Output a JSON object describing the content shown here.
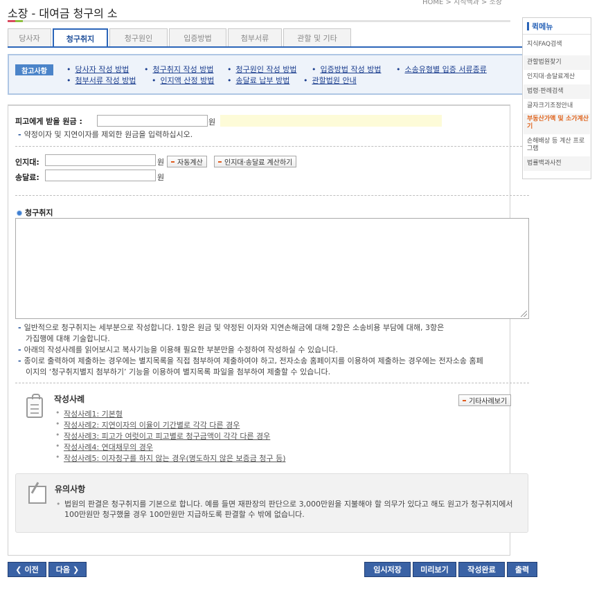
{
  "header": {
    "breadcrumb": "HOME > 지식백과 > 소장",
    "title": "소장 - 대여금 청구의 소"
  },
  "tabs": [
    {
      "label": "당사자"
    },
    {
      "label": "청구취지"
    },
    {
      "label": "청구원인"
    },
    {
      "label": "입증방법"
    },
    {
      "label": "첨부서류"
    },
    {
      "label": "관할 및 기타"
    }
  ],
  "notice": {
    "badge": "참고사항",
    "links": [
      "당사자 작성 방법",
      "청구취지 작성 방법",
      "청구원인 작성 방법",
      "입증방법 작성 방법",
      "소송유형별 입증 서류종류",
      "첨부서류 작성 방법",
      "인지액 산정 방법",
      "송달료 납부 방법",
      "관할법원 안내"
    ]
  },
  "form": {
    "principal_label": "피고에게 받을 원금 :",
    "principal_value": "",
    "unit_won": "원",
    "principal_note": "약정이자 및 지연이자를 제외한 원금을 입력하십시오.",
    "stamp_label": "인지대:",
    "stamp_value": "",
    "auto_calc_btn": "자동계산",
    "stamp_only_btn": "인지대·송달료 계산하기",
    "delivery_label": "송달료:",
    "delivery_value": "",
    "claim_section_title": "청구취지",
    "claim_text": "",
    "notes": [
      "일반적으로 청구취지는 세부분으로 작성합니다. 1항은 원금 및 약정된 이자와 지연손해금에 대해 2항은 소송비용 부담에 대해, 3항은",
      "가집행에 대해 기술합니다.",
      "아래의 작성사례를 읽어보시고 복사기능을 이용해 필요한 부분만을 수정하여 작성하실 수 있습니다.",
      "종이로 출력하여 제출하는 경우에는 별지목록을 직접 첨부하여 제출하여야 하고, 전자소송 홈페이지를 이용하여 제출하는 경우에는 전자소송 홈페",
      "이지의 ‘청구취지별지 첨부하기’ 기능을 이용하여 별지목록 파일을 첨부하여 제출할 수 있습니다."
    ]
  },
  "examples": {
    "title": "작성사례",
    "more_btn": "기타사례보기",
    "items": [
      "작성사례1: 기본형",
      "작성사례2: 지연이자의 이율이 기간별로 각각 다른 경우",
      "작성사례3: 피고가 여럿이고 피고별로 청구금액이 각각 다른 경우",
      "작성사례4: 연대채무의 경우",
      "작성사례5: 이자청구를 하지 않는 경우(명도하지 않은 보증금 청구 등)"
    ]
  },
  "caution": {
    "title": "유의사항",
    "text": "법원의 판결은 청구취지를 기본으로 합니다. 예를 들면 재판장의 판단으로 3,000만원을 지불해야 할 의무가 있다고 해도 원고가 청구취지에서 100만원만 청구했을 경우 100만원만 지급하도록 판결할 수 밖에 없습니다."
  },
  "buttons": {
    "prev": "이전",
    "next": "다음",
    "temp_save": "임시저장",
    "preview": "미리보기",
    "complete": "작성완료",
    "print": "출력"
  },
  "quick_menu": {
    "title": "퀵메뉴",
    "items": [
      "지식FAQ검색",
      "관할법원찾기",
      "인지대·송달료계산",
      "법령·판례검색",
      "글자크기조정안내",
      "부동산가액 및 소가계산기",
      "손해배상 등 계산 프로그램",
      "법률백과사전"
    ]
  },
  "colors": {
    "accent": "#2a64b8",
    "nav_button": "#3a62a5",
    "highlight": "#e0651e"
  }
}
